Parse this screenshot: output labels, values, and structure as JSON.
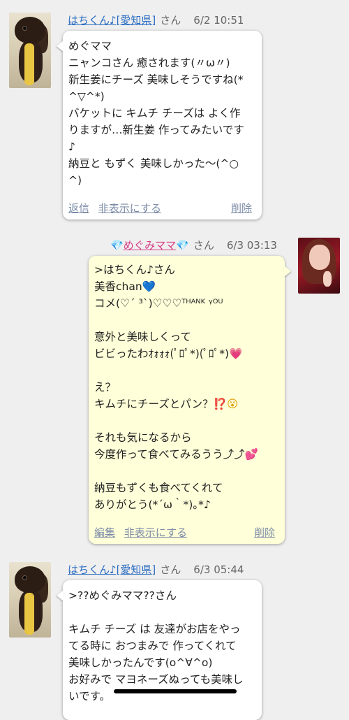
{
  "posts": [
    {
      "user": "はちくん♪[愛知県]",
      "san": "さん",
      "time": "6/2 10:51",
      "lines": [
        "めぐママ",
        "ニャンコさん 癒されます(〃ω〃)",
        "新生姜にチーズ 美味しそうですね(*",
        "^▽^*)",
        "バケットに キムチ チーズは よく作",
        "りますが…新生姜 作ってみたいです",
        "♪",
        "納豆と もずく 美味しかった〜(^○",
        "^)"
      ],
      "actions": {
        "reply": "返信",
        "hide": "非表示にする",
        "delete": "削除"
      }
    },
    {
      "user": "めぐみママ",
      "gem": "💎",
      "san": "さん",
      "time": "6/3 03:13",
      "lines": [
        ">はちくん♪さん",
        "美香chan",
        "コメ(♡´ ³`)♡♡♡ᵀᴴᴬᴺᴷ ᵞᴼᵁ",
        "",
        "意外と美味しくって",
        "ビビったわｵｫｫｫ(ﾟﾛﾟ*)(ﾟﾛﾟ*)",
        "",
        "え？",
        "キムチにチーズとパン？",
        "",
        "それも気になるから",
        "今度作って食べてみるうう⤴︎⤴︎",
        "",
        "納豆もずくも食べてくれて",
        "ありがとう(*´ω｀*)｡*♪"
      ],
      "emoji": {
        "blue_heart": "💙",
        "sparkle_heart": "💗",
        "exclamation_question": "⁉️",
        "wow_face": "😮",
        "two_hearts": "💕"
      },
      "actions": {
        "edit": "編集",
        "hide": "非表示にする",
        "delete": "削除"
      }
    },
    {
      "user": "はちくん♪[愛知県]",
      "san": "さん",
      "time": "6/3 05:44",
      "lines": [
        ">??めぐみママ??さん",
        "",
        "キムチ チーズ は 友達がお店をやっ",
        "てる時に おつまみで 作ってくれて",
        "美味しかったんです(o^∀^o)",
        "お好みで マヨネーズぬっても美味し",
        "いです。"
      ]
    }
  ],
  "colors": {
    "background": "#efefef",
    "user_link": "#2a6cc3",
    "own_user": "#d83c86",
    "own_bubble": "#ffffd9",
    "other_bubble": "#ffffff"
  },
  "icons": [
    "dog-avatar",
    "user-photo-avatar",
    "gem-icon",
    "home-indicator"
  ]
}
